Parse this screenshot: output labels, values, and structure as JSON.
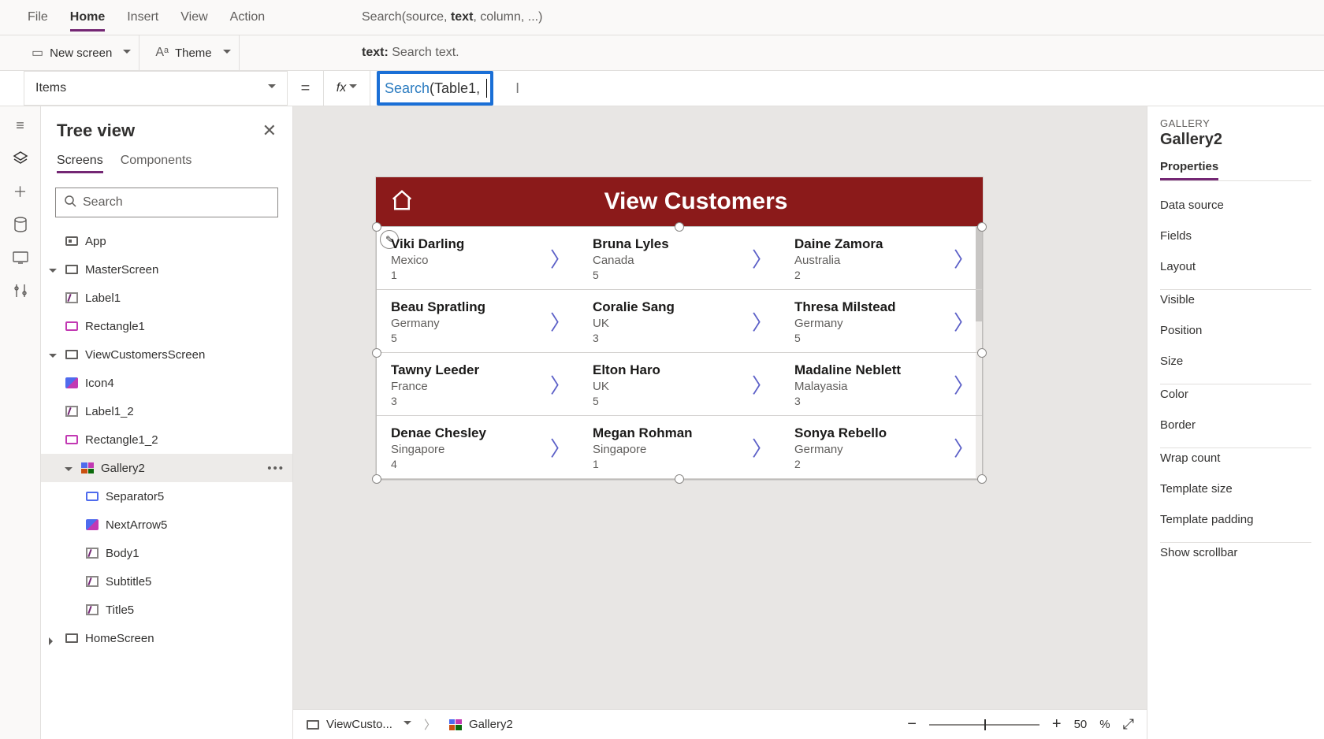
{
  "menu": {
    "file": "File",
    "home": "Home",
    "insert": "Insert",
    "view": "View",
    "action": "Action"
  },
  "intellisense": {
    "prefix": "Search(source, ",
    "highlighted": "text",
    "suffix": ", column, ...)"
  },
  "ribbon": {
    "newscreen": "New screen",
    "theme": "Theme"
  },
  "paramhelp": {
    "name": "text:",
    "desc": "Search text."
  },
  "property_dropdown": "Items",
  "formula": {
    "func": "Search",
    "rest": "(Table1, "
  },
  "treeview": {
    "title": "Tree view",
    "tabs": {
      "screens": "Screens",
      "components": "Components"
    },
    "search_placeholder": "Search",
    "app": "App",
    "items": [
      {
        "label": "MasterScreen",
        "level": 1,
        "type": "screen",
        "exp": true
      },
      {
        "label": "Label1",
        "level": 2,
        "type": "label"
      },
      {
        "label": "Rectangle1",
        "level": 2,
        "type": "rect"
      },
      {
        "label": "ViewCustomersScreen",
        "level": 1,
        "type": "screen",
        "exp": true
      },
      {
        "label": "Icon4",
        "level": 2,
        "type": "icon"
      },
      {
        "label": "Label1_2",
        "level": 2,
        "type": "label"
      },
      {
        "label": "Rectangle1_2",
        "level": 2,
        "type": "rect"
      },
      {
        "label": "Gallery2",
        "level": 2,
        "type": "gallery",
        "exp": true,
        "selected": true
      },
      {
        "label": "Separator5",
        "level": 3,
        "type": "sep"
      },
      {
        "label": "NextArrow5",
        "level": 3,
        "type": "icon"
      },
      {
        "label": "Body1",
        "level": 3,
        "type": "label"
      },
      {
        "label": "Subtitle5",
        "level": 3,
        "type": "label"
      },
      {
        "label": "Title5",
        "level": 3,
        "type": "label"
      },
      {
        "label": "HomeScreen",
        "level": 1,
        "type": "screen",
        "exp": false
      }
    ]
  },
  "canvas": {
    "header_title": "View Customers",
    "rows": [
      [
        {
          "name": "Viki  Darling",
          "sub": "Mexico",
          "num": "1"
        },
        {
          "name": "Bruna  Lyles",
          "sub": "Canada",
          "num": "5"
        },
        {
          "name": "Daine  Zamora",
          "sub": "Australia",
          "num": "2"
        }
      ],
      [
        {
          "name": "Beau  Spratling",
          "sub": "Germany",
          "num": "5"
        },
        {
          "name": "Coralie  Sang",
          "sub": "UK",
          "num": "3"
        },
        {
          "name": "Thresa  Milstead",
          "sub": "Germany",
          "num": "5"
        }
      ],
      [
        {
          "name": "Tawny  Leeder",
          "sub": "France",
          "num": "3"
        },
        {
          "name": "Elton  Haro",
          "sub": "UK",
          "num": "5"
        },
        {
          "name": "Madaline  Neblett",
          "sub": "Malayasia",
          "num": "3"
        }
      ],
      [
        {
          "name": "Denae  Chesley",
          "sub": "Singapore",
          "num": "4"
        },
        {
          "name": "Megan  Rohman",
          "sub": "Singapore",
          "num": "1"
        },
        {
          "name": "Sonya  Rebello",
          "sub": "Germany",
          "num": "2"
        }
      ]
    ]
  },
  "breadcrumb": {
    "screen": "ViewCusto...",
    "control": "Gallery2"
  },
  "zoom": {
    "value": "50",
    "pct": "%"
  },
  "properties": {
    "type": "GALLERY",
    "name": "Gallery2",
    "tab": "Properties",
    "rows": [
      "Data source",
      "Fields",
      "Layout",
      "Visible",
      "Position",
      "Size",
      "Color",
      "Border",
      "Wrap count",
      "Template size",
      "Template padding"
    ],
    "showscroll": "Show scrollbar"
  }
}
